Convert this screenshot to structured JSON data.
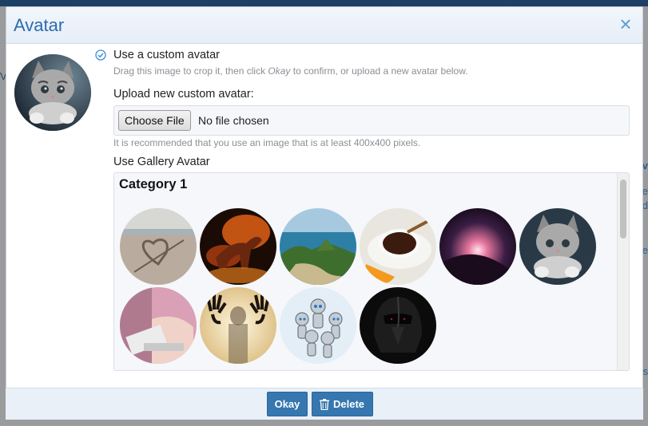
{
  "background": {
    "edge_texts": [
      "Va",
      "v",
      "e",
      "d",
      "e",
      "s"
    ]
  },
  "dialog": {
    "title": "Avatar",
    "close_glyph": "×",
    "custom_avatar": {
      "label": "Use a custom avatar",
      "hint_before": "Drag this image to crop it, then click ",
      "hint_emphasis": "Okay",
      "hint_after": " to confirm, or upload a new avatar below.",
      "selected": true
    },
    "upload": {
      "label": "Upload new custom avatar:",
      "button_label": "Choose File",
      "status": "No file chosen",
      "hint": "It is recommended that you use an image that is at least 400x400 pixels."
    },
    "gallery": {
      "label": "Use Gallery Avatar",
      "category": "Category 1",
      "images": [
        "heart-in-sand-thumbnail",
        "fire-horse-thumbnail",
        "coastal-island-thumbnail",
        "coffee-cup-orange-thumbnail",
        "planet-sunrise-thumbnail",
        "kitten-thumbnail",
        "woman-typing-keyboard-thumbnail",
        "hands-behind-glass-thumbnail",
        "robots-group-thumbnail",
        "darth-vader-thumbnail"
      ]
    },
    "footer": {
      "okay_label": "Okay",
      "delete_label": "Delete"
    }
  },
  "colors": {
    "accent": "#3577ae",
    "title": "#2b6cb0"
  }
}
